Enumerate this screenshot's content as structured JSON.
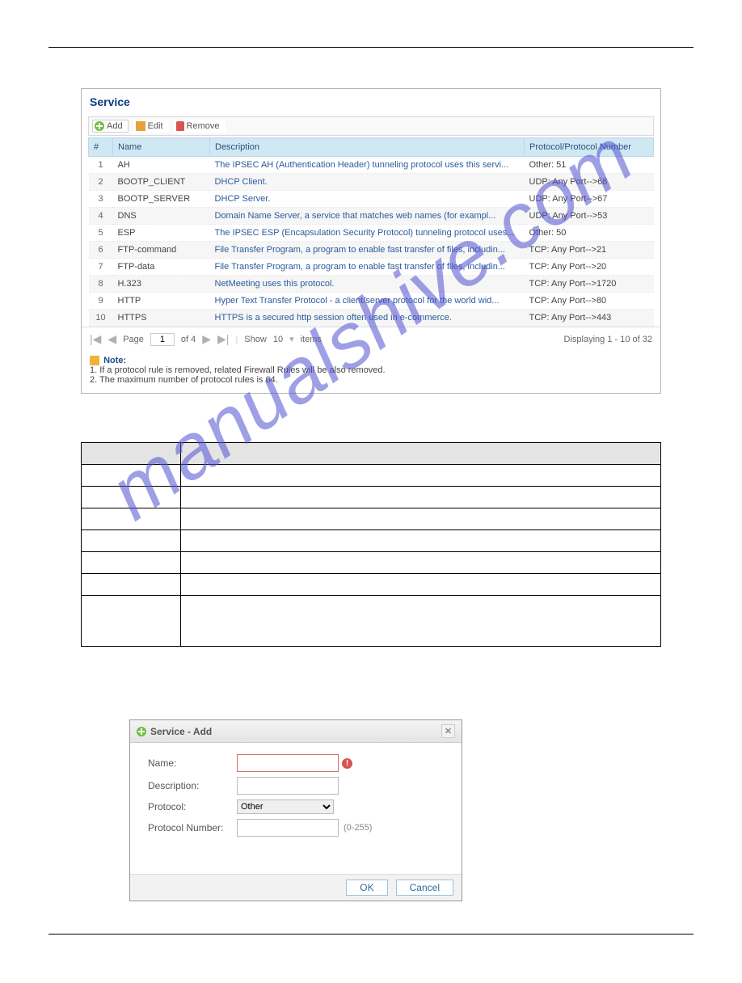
{
  "watermark": "manualshive.com",
  "panel": {
    "title": "Service",
    "toolbar": {
      "add": "Add",
      "edit": "Edit",
      "remove": "Remove"
    },
    "headers": {
      "num": "#",
      "name": "Name",
      "desc": "Description",
      "proto": "Protocol/Protocol Number"
    },
    "rows": [
      {
        "n": "1",
        "name": "AH",
        "desc": "The IPSEC AH (Authentication Header) tunneling protocol uses this servi...",
        "proto": "Other: 51"
      },
      {
        "n": "2",
        "name": "BOOTP_CLIENT",
        "desc": "DHCP Client.",
        "proto": "UDP: Any Port-->68"
      },
      {
        "n": "3",
        "name": "BOOTP_SERVER",
        "desc": "DHCP Server.",
        "proto": "UDP: Any Port-->67"
      },
      {
        "n": "4",
        "name": "DNS",
        "desc": "Domain Name Server, a service that matches web names (for exampl...",
        "proto": "UDP: Any Port-->53"
      },
      {
        "n": "5",
        "name": "ESP",
        "desc": "The IPSEC ESP (Encapsulation Security Protocol) tunneling protocol uses...",
        "proto": "Other: 50"
      },
      {
        "n": "6",
        "name": "FTP-command",
        "desc": "File Transfer Program, a program to enable fast transfer of files, includin...",
        "proto": "TCP: Any Port-->21"
      },
      {
        "n": "7",
        "name": "FTP-data",
        "desc": "File Transfer Program, a program to enable fast transfer of files, includin...",
        "proto": "TCP: Any Port-->20"
      },
      {
        "n": "8",
        "name": "H.323",
        "desc": "NetMeeting uses this protocol.",
        "proto": "TCP: Any Port-->1720"
      },
      {
        "n": "9",
        "name": "HTTP",
        "desc": "Hyper Text Transfer Protocol - a client/server protocol for the world wid...",
        "proto": "TCP: Any Port-->80"
      },
      {
        "n": "10",
        "name": "HTTPS",
        "desc": "HTTPS is a secured http session often used in e-commerce.",
        "proto": "TCP: Any Port-->443"
      }
    ],
    "pager": {
      "page_label": "Page",
      "page_val": "1",
      "of": "of 4",
      "show_label": "Show",
      "show_val": "10",
      "items": "items",
      "summary": "Displaying 1 - 10 of 32"
    },
    "note": {
      "head": "Note:",
      "l1": "1. If a protocol rule is removed, related Firewall Rules will be also removed.",
      "l2": "2. The maximum number of protocol rules is 64."
    }
  },
  "dialog": {
    "title": "Service - Add",
    "fields": {
      "name": "Name:",
      "desc": "Description:",
      "proto": "Protocol:",
      "proto_val": "Other",
      "pnum": "Protocol Number:",
      "pnum_hint": "(0-255)"
    },
    "ok": "OK",
    "cancel": "Cancel"
  }
}
